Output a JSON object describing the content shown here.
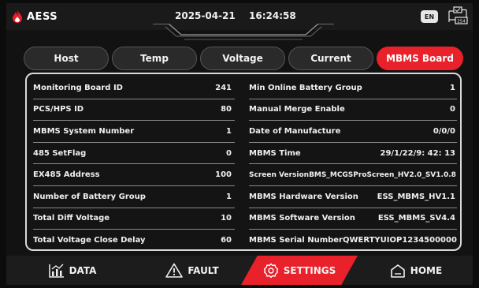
{
  "header": {
    "logo_text": "AESS",
    "date": "2025-04-21",
    "time": "16:24:58",
    "lang_badge": "EN",
    "net_label": "254"
  },
  "tabs": [
    {
      "label": "Host",
      "active": false
    },
    {
      "label": "Temp",
      "active": false
    },
    {
      "label": "Voltage",
      "active": false
    },
    {
      "label": "Current",
      "active": false
    },
    {
      "label": "MBMS Board",
      "active": true
    }
  ],
  "left_rows": [
    {
      "label": "Monitoring Board ID",
      "value": "241"
    },
    {
      "label": "PCS/HPS ID",
      "value": "80"
    },
    {
      "label": "MBMS System Number",
      "value": "1"
    },
    {
      "label": "485 SetFlag",
      "value": "0"
    },
    {
      "label": "EX485 Address",
      "value": "100"
    },
    {
      "label": "Number of Battery Group",
      "value": "1"
    },
    {
      "label": "Total Diff Voltage",
      "value": "10"
    },
    {
      "label": "Total Voltage Close Delay",
      "value": "60"
    }
  ],
  "right_rows": [
    {
      "label": "Min Online Battery Group",
      "value": "1"
    },
    {
      "label": "Manual Merge Enable",
      "value": "0"
    },
    {
      "label": "Date of Manufacture",
      "value": "0/0/0"
    },
    {
      "label": "MBMS Time",
      "value": "29/1/22/9: 42: 13"
    },
    {
      "label": "Screen Version",
      "value": "BMS_MCGSProScreen_HV2.0_SV1.0.8"
    },
    {
      "label": "MBMS Hardware Version",
      "value": "ESS_MBMS_HV1.1"
    },
    {
      "label": "MBMS Software Version",
      "value": "ESS_MBMS_SV4.4"
    },
    {
      "label": "MBMS Serial Number",
      "value": "QWERTYUIOP1234500000"
    }
  ],
  "nav": {
    "data": "DATA",
    "fault": "FAULT",
    "settings": "SETTINGS",
    "home": "HOME"
  },
  "colors": {
    "accent": "#e8212b",
    "background": "#121212",
    "panel_border": "#d9d9d9"
  }
}
